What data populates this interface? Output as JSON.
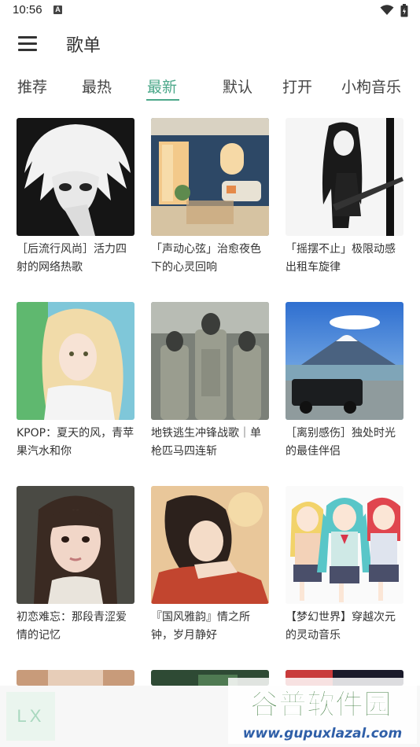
{
  "status": {
    "time": "10:56",
    "notification": "A"
  },
  "header": {
    "title": "歌单"
  },
  "tabs": [
    {
      "label": "推荐"
    },
    {
      "label": "最热"
    },
    {
      "label": "最新",
      "active": true
    },
    {
      "label": "默认"
    },
    {
      "label": "打开"
    },
    {
      "label": "小枸音乐"
    }
  ],
  "playlists": [
    {
      "title": "［后流行风尚］活力四射的网络热歌"
    },
    {
      "title": "「声动心弦」治愈夜色下的心灵回响"
    },
    {
      "title": "「摇摆不止」极限动感出租车旋律"
    },
    {
      "title": "KPOP：夏天的风，青苹果汽水和你"
    },
    {
      "title": "地铁逃生冲锋战歌｜单枪匹马四连斩"
    },
    {
      "title": "［离别感伤］独处时光的最佳伴侣"
    },
    {
      "title": "初恋难忘：那段青涩爱情的记忆"
    },
    {
      "title": "『国风雅韵』情之所钟，岁月静好"
    },
    {
      "title": "【梦幻世界】穿越次元的灵动音乐"
    }
  ],
  "player": {
    "logo": "LX"
  },
  "watermark": {
    "main": "谷普软件园",
    "url": "www.gupuxlazal.com"
  },
  "colors": {
    "accent": "#4ca88a",
    "text": "#333333",
    "player_bg": "#f7f7f7"
  }
}
